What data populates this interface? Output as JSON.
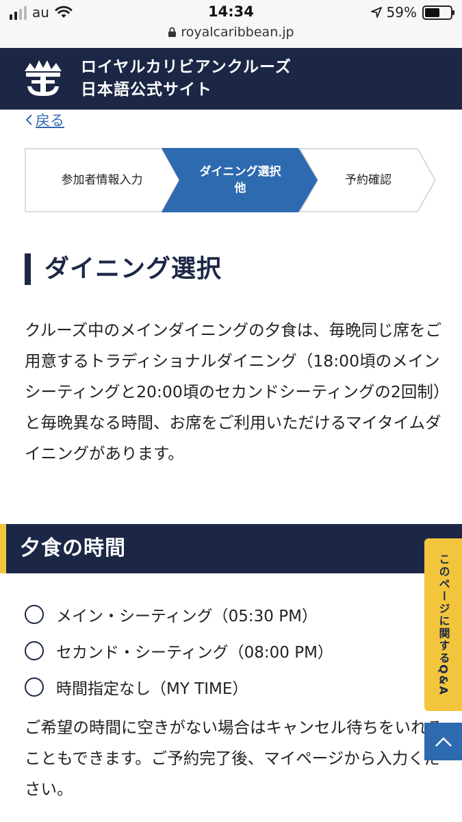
{
  "status_bar": {
    "carrier": "au",
    "time": "14:34",
    "battery_percent": "59%",
    "battery_level": 0.59,
    "url": "royalcaribbean.jp",
    "icons": [
      "signal-icon",
      "wifi-icon",
      "location-arrow-icon",
      "battery-icon",
      "lock-icon"
    ]
  },
  "header": {
    "brand_line1": "ロイヤルカリビアンクルーズ",
    "brand_line2": "日本語公式サイト",
    "logo_icon": "crown-anchor-logo"
  },
  "back_link": {
    "label": "戻る",
    "icon": "chevron-left-icon"
  },
  "stepper": {
    "steps": [
      {
        "label": "参加者情報入力",
        "active": false
      },
      {
        "label": "ダイニング選択\n他",
        "active": true
      },
      {
        "label": "予約確認",
        "active": false
      }
    ]
  },
  "main": {
    "section_title": "ダイニング選択",
    "intro": "クルーズ中のメインダイニングの夕食は、毎晩同じ席をご用意するトラディショナルダイニング（18:00頃のメインシーティングと20:00頃のセカンドシーティングの2回制）と毎晩異なる時間、お席をご利用いただけるマイタイムダイニングがあります。",
    "dinner_heading": "夕食の時間",
    "options": [
      {
        "label": "メイン・シーティング（05:30 PM）"
      },
      {
        "label": "セカンド・シーティング（08:00 PM）"
      },
      {
        "label": "時間指定なし（MY TIME）"
      }
    ],
    "note": "ご希望の時間に空きがない場合はキャンセル待ちをいれることもできます。ご予約完了後、マイページから入力ください。"
  },
  "floating": {
    "qa_label": "このページに関するQ&A",
    "scroll_top_icon": "chevron-up-icon"
  },
  "colors": {
    "navy": "#1c2746",
    "blue": "#2d6ab0",
    "accent_yellow": "#f2c53d"
  }
}
